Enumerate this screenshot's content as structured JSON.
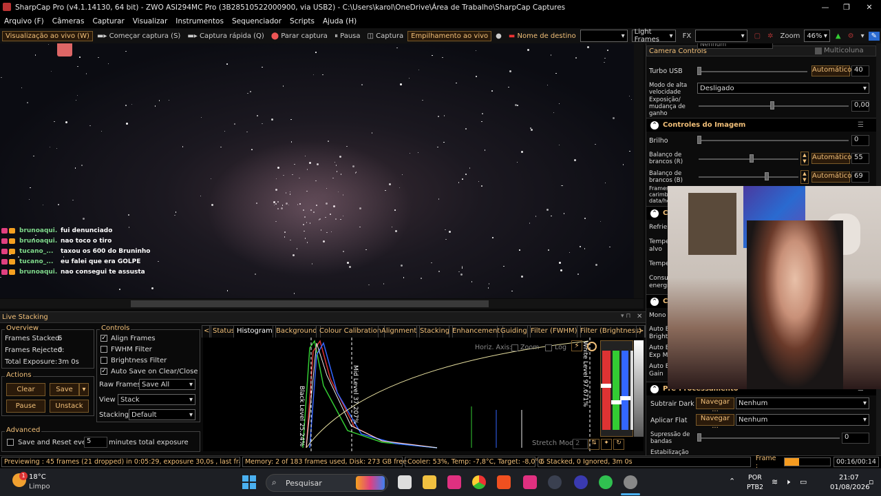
{
  "window": {
    "title": "SharpCap Pro (v4.1.14130, 64 bit) - ZWO ASI294MC Pro (3B28510522000900, via USB2) - C:\\Users\\karol\\OneDrive\\Área de Trabalho\\SharpCap Captures",
    "minimize": "—",
    "maximize": "❐",
    "close": "✕"
  },
  "menu": [
    "Arquivo (F)",
    "Câmeras",
    "Capturar",
    "Visualizar",
    "Instrumentos",
    "Sequenciador",
    "Scripts",
    "Ajuda (H)"
  ],
  "toolbar": {
    "live_view": "Visualização ao vivo (W)",
    "start_capture": "Começar captura (S)",
    "quick_capture": "Captura rápida (Q)",
    "stop_capture": "Parar captura",
    "pause": "Pausa",
    "capture": "Captura",
    "live_stack": "Empilhamento ao vivo",
    "target_name": "Nome de destino",
    "frame_type": "Light Frames",
    "fx": "FX",
    "zoom_label": "Zoom",
    "zoom_value": "46%"
  },
  "chat": [
    {
      "user": "brunoaqui...",
      "msg": "fui denunciado",
      "color": "#7fd98b"
    },
    {
      "user": "brunoaqui...",
      "msg": "nao toco o tiro",
      "color": "#7fd98b"
    },
    {
      "user": "tucano_...",
      "msg": "taxou os 600 do Bruninho",
      "color": "#7fd98b"
    },
    {
      "user": "tucano_...",
      "msg": "eu falei que era GOLPE",
      "color": "#7fd98b"
    },
    {
      "user": "brunoaqui...",
      "msg": "nao consegui te assusta",
      "color": "#7fd98b"
    }
  ],
  "camera_controls": {
    "title": "Camera Controls",
    "multicolumn": "Multicoluna",
    "top_value": "Nenhum",
    "turbo_usb": {
      "label": "Turbo USB",
      "mode": "Automático",
      "value": "40"
    },
    "high_speed": {
      "label": "Modo de alta velocidade",
      "value": "Desligado"
    },
    "exposure_gain": {
      "label": "Exposição/ mudança de ganho",
      "value": "0,00"
    },
    "image_controls": "Controles do Imagem",
    "brightness": {
      "label": "Brilho",
      "value": "0"
    },
    "wb_r": {
      "label": "Balanço de brancos (R)",
      "mode": "Automático",
      "value": "55"
    },
    "wb_b": {
      "label": "Balanço de brancos (B)",
      "mode": "Automático",
      "value": "69"
    },
    "frames_label": "Frames carimb data/hora",
    "cooler_section": "C",
    "refresh": "Refrie",
    "temp_target": "Tempe alvo",
    "temp": "Tempe",
    "consumption": "Consu energi",
    "color_section": "C",
    "mono_bin": "Mono B",
    "auto_bright": "Auto E Bright",
    "auto_exp": "Auto E Exp M",
    "auto_gain": "Auto E Gain",
    "preprocessing": "Pré-Processamento",
    "subtract_dark": {
      "label": "Subtrair Dark",
      "browse": "Navegar ...",
      "value": "Nenhum"
    },
    "apply_flat": {
      "label": "Aplicar Flat",
      "browse": "Navegar ...",
      "value": "Nenhum"
    },
    "band_suppression": {
      "label": "Supressão de bandas",
      "value": "0"
    },
    "stabilization": "Estabilização"
  },
  "live_stacking": {
    "title": "Live Stacking",
    "overview_title": "Overview",
    "frames_stacked_label": "Frames Stacked:",
    "frames_stacked": "6",
    "frames_rejected_label": "Frames Rejected:",
    "frames_rejected": "0",
    "total_exposure_label": "Total Exposure:",
    "total_exposure": "3m 0s",
    "actions_title": "Actions",
    "clear": "Clear",
    "save": "Save",
    "pause": "Pause",
    "unstack": "Unstack",
    "controls_title": "Controls",
    "align_frames": "Align Frames",
    "fwhm_filter": "FWHM Filter",
    "brightness_filter": "Brightness Filter",
    "auto_save": "Auto Save on Clear/Close",
    "raw_frames_label": "Raw Frames",
    "raw_frames": "Save All",
    "view_label": "View",
    "view": "Stack",
    "stacking_label": "Stacking",
    "stacking": "Default",
    "advanced_title": "Advanced",
    "save_reset": "Save and Reset every",
    "save_reset_value": "5",
    "minutes_total": "minutes total exposure",
    "tabs": [
      "Status",
      "Histogram",
      "Background",
      "Colour Calibration",
      "Alignment",
      "Stacking",
      "Enhancement",
      "Guiding",
      "Filter (FWHM)",
      "Filter (Brightness)"
    ],
    "horiz_axis": "Horiz. Axis:",
    "zoom": "Zoom",
    "log": "Log",
    "black_level": "Black Level 25.24%",
    "mid_level": "Mid Level 37.207%",
    "white_level": "White Level 97.671%",
    "stretch_mode": "Stretch Mode",
    "stretch_value": "2"
  },
  "status": {
    "preview": "Previewing : 45 frames (21 dropped) in 0:05:29, exposure 30,0s , last frame 31,0s",
    "memory": "Memory: 2 of 183 frames used, Disk: 273 GB free",
    "cooler": "Cooler: 53%, Temp: -7,8°C, Target: -8,0°C",
    "stack": "6 Stacked, 0 Ignored, 3m 0s",
    "frame_label": "Frame :",
    "frame_time": "00:16/00:14",
    "frame_progress": 0.32
  },
  "taskbar": {
    "temp": "18°C",
    "weather": "Limpo",
    "search": "Pesquisar",
    "lang1": "POR",
    "lang2": "PTB2",
    "time": "21:07",
    "date": "01/08/2026",
    "notif": "1"
  }
}
